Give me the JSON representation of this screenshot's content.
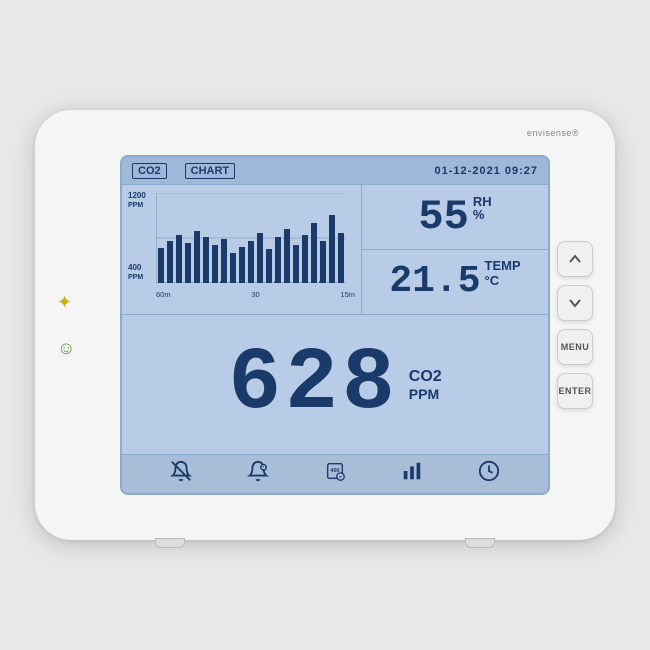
{
  "brand": {
    "name": "envisense",
    "trademark": "®"
  },
  "topbar": {
    "co2_label": "CO2",
    "chart_label": "CHART",
    "datetime": "01-12-2021 09:27"
  },
  "chart": {
    "y_top": "1200",
    "y_top_unit": "PPM",
    "y_bottom": "400",
    "y_bottom_unit": "PPM",
    "x_labels": [
      "60m",
      "30",
      "15m"
    ]
  },
  "readings": {
    "humidity_value": "55",
    "humidity_unit": "RH%",
    "temp_value": "21.5",
    "temp_unit": "TEMP °C"
  },
  "co2": {
    "value": "628",
    "label": "CO2",
    "unit": "PPM"
  },
  "buttons": {
    "up": "∧",
    "down": "∨",
    "menu": "MENU",
    "enter": "ENTER"
  },
  "indicators": {
    "sun": "✦",
    "smile": "☺"
  },
  "bottom_icons": [
    "🔔",
    "🔔",
    "⚙",
    "📊",
    "🕐"
  ]
}
